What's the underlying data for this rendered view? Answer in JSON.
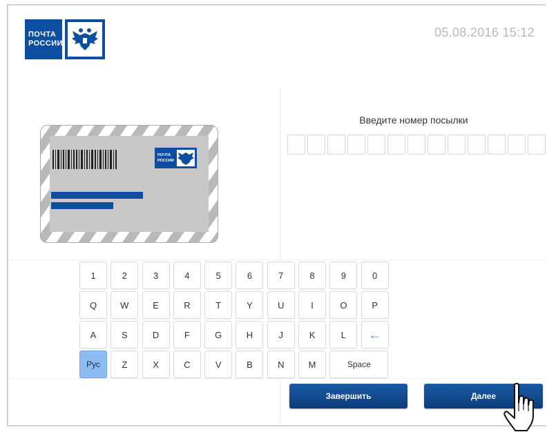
{
  "header": {
    "logo_line1": "ПОЧТА",
    "logo_line2": "РОССИИ",
    "datetime": "05.08.2016  15:12"
  },
  "illustration": {
    "mini_logo_line1": "ПОЧТА",
    "mini_logo_line2": "РОССИИ"
  },
  "input": {
    "prompt": "Введите номер посылки",
    "cell_count": 13
  },
  "keyboard": {
    "rows": [
      [
        "1",
        "2",
        "3",
        "4",
        "5",
        "6",
        "7",
        "8",
        "9",
        "0"
      ],
      [
        "Q",
        "W",
        "E",
        "R",
        "T",
        "Y",
        "U",
        "I",
        "O",
        "P"
      ],
      [
        "A",
        "S",
        "D",
        "F",
        "G",
        "H",
        "J",
        "K",
        "L",
        "←"
      ],
      [
        "Рус",
        "Z",
        "X",
        "C",
        "V",
        "B",
        "N",
        "M",
        "Space"
      ]
    ],
    "active_key": "Рус"
  },
  "actions": {
    "finish_label": "Завершить",
    "next_label": "Далее"
  },
  "colors": {
    "brand_blue": "#0d4ea1",
    "button_blue": "#1b5aa6",
    "active_key": "#8dbcf2",
    "backspace": "#3e8ce8"
  },
  "icons": {
    "emblem": "eagle-emblem-icon",
    "backspace": "backspace-arrow-icon",
    "cursor": "hand-pointer-icon"
  }
}
